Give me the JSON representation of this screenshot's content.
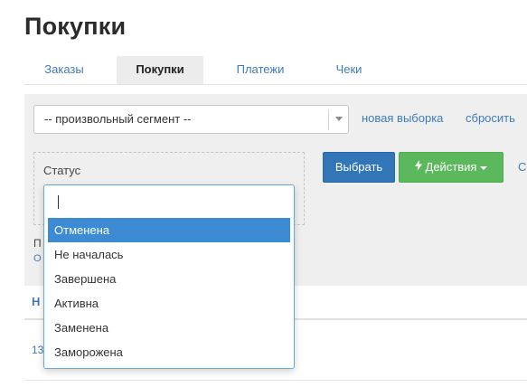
{
  "page": {
    "title": "Покупки"
  },
  "tabs": [
    {
      "label": "Заказы"
    },
    {
      "label": "Покупки",
      "active": true
    },
    {
      "label": "Платежи"
    },
    {
      "label": "Чеки"
    }
  ],
  "filters": {
    "segment_value": "-- произвольный сегмент --",
    "new_selection_link": "новая выборка",
    "reset_link": "сбросить",
    "status_label": "Статус",
    "select_button": "Выбрать",
    "actions_button": "Действия",
    "edge_link": "С",
    "below_text": "П",
    "below_link": "О"
  },
  "table": {
    "col_header": "Н",
    "first_cell": "13"
  },
  "status_dropdown": {
    "search_value": "",
    "options": [
      {
        "label": "Отменена",
        "selected": true
      },
      {
        "label": "Не началась"
      },
      {
        "label": "Завершена"
      },
      {
        "label": "Активна"
      },
      {
        "label": "Заменена"
      },
      {
        "label": "Заморожена"
      }
    ]
  },
  "colors": {
    "primary_button": "#3276b7",
    "success_button": "#5cb85c",
    "link": "#3f7bb8",
    "highlight": "#3d8bd3"
  }
}
